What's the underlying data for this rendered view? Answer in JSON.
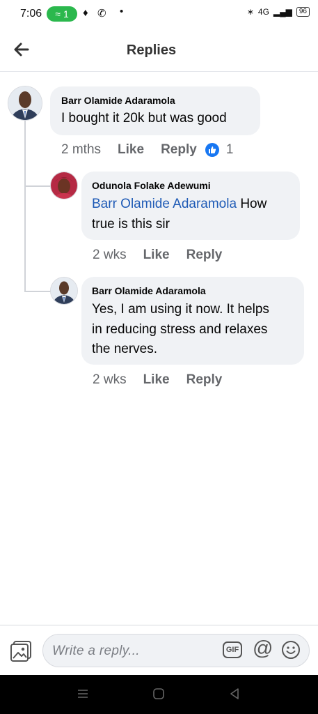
{
  "status_bar": {
    "time": "7:06",
    "hotspot_count": "1",
    "network": "4G",
    "battery": "96"
  },
  "header": {
    "title": "Replies"
  },
  "comments": [
    {
      "author": "Barr Olamide Adaramola",
      "text": "I bought it 20k but was good",
      "time": "2 mths",
      "like_label": "Like",
      "reply_label": "Reply",
      "reaction_count": "1"
    },
    {
      "author": "Odunola Folake Adewumi",
      "mention": "Barr Olamide Adaramola",
      "text_line1_rest": " How",
      "text_line2": "true is this sir",
      "time": "2 wks",
      "like_label": "Like",
      "reply_label": "Reply"
    },
    {
      "author": "Barr Olamide Adaramola",
      "text_line1": "Yes, I am using it now. It helps",
      "text_line2": "in reducing stress and relaxes",
      "text_line3": "the nerves.",
      "time": "2 wks",
      "like_label": "Like",
      "reply_label": "Reply"
    }
  ],
  "composer": {
    "placeholder": "Write a reply...",
    "gif_label": "GIF",
    "at_label": "@"
  },
  "colors": {
    "accent": "#1877f2",
    "mention": "#1f5bb6",
    "bubble": "#f0f2f5",
    "secondary_text": "#65676b"
  }
}
